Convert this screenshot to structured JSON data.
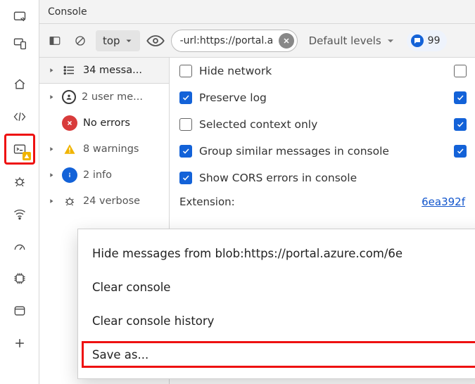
{
  "title": "Console",
  "toolbar": {
    "context": "top",
    "filter": "-url:https://portal.a",
    "levels": "Default levels",
    "issues_count": "99"
  },
  "sidebar": {
    "items": [
      {
        "label": "34 messa..."
      },
      {
        "label": "2 user me..."
      },
      {
        "label": "No errors"
      },
      {
        "label": "8 warnings"
      },
      {
        "label": "2 info"
      },
      {
        "label": "24 verbose"
      }
    ]
  },
  "settings": {
    "hide_network": {
      "label": "Hide network",
      "checked": false,
      "trail": false
    },
    "preserve_log": {
      "label": "Preserve log",
      "checked": true,
      "trail": true
    },
    "selected_only": {
      "label": "Selected context only",
      "checked": false,
      "trail": true
    },
    "group_similar": {
      "label": "Group similar messages in console",
      "checked": true,
      "trail": true
    },
    "cors": {
      "label": "Show CORS errors in console",
      "checked": true
    }
  },
  "extension": {
    "label": "Extension:",
    "value": "6ea392f"
  },
  "context_menu": {
    "items": [
      "Hide messages from blob:https://portal.azure.com/6e",
      "Clear console",
      "Clear console history",
      "Save as..."
    ]
  }
}
